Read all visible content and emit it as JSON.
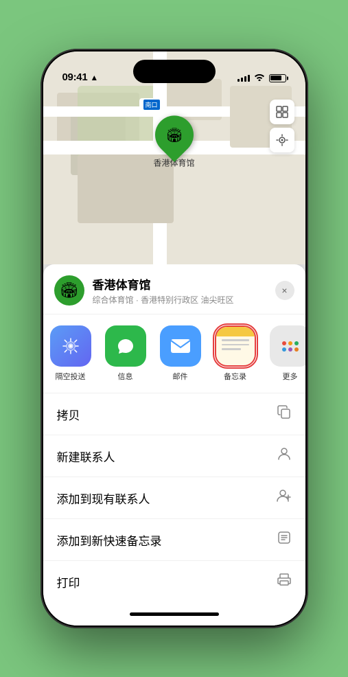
{
  "status": {
    "time": "09:41",
    "location_arrow": "▲"
  },
  "map": {
    "label_text": "南口",
    "location_name": "香港体育馆",
    "pin_emoji": "🏟️"
  },
  "sheet": {
    "venue_name": "香港体育馆",
    "venue_subtitle": "综合体育馆 · 香港特别行政区 油尖旺区",
    "close_label": "×"
  },
  "share_items": [
    {
      "id": "airdrop",
      "label": "隔空投送",
      "type": "airdrop"
    },
    {
      "id": "messages",
      "label": "信息",
      "type": "messages"
    },
    {
      "id": "mail",
      "label": "邮件",
      "type": "mail"
    },
    {
      "id": "notes",
      "label": "备忘录",
      "type": "notes"
    },
    {
      "id": "more",
      "label": "更多",
      "type": "more"
    }
  ],
  "actions": [
    {
      "id": "copy",
      "label": "拷贝",
      "icon": "copy"
    },
    {
      "id": "new-contact",
      "label": "新建联系人",
      "icon": "person"
    },
    {
      "id": "add-existing",
      "label": "添加到现有联系人",
      "icon": "person-add"
    },
    {
      "id": "add-notes",
      "label": "添加到新快速备忘录",
      "icon": "note"
    },
    {
      "id": "print",
      "label": "打印",
      "icon": "print"
    }
  ]
}
